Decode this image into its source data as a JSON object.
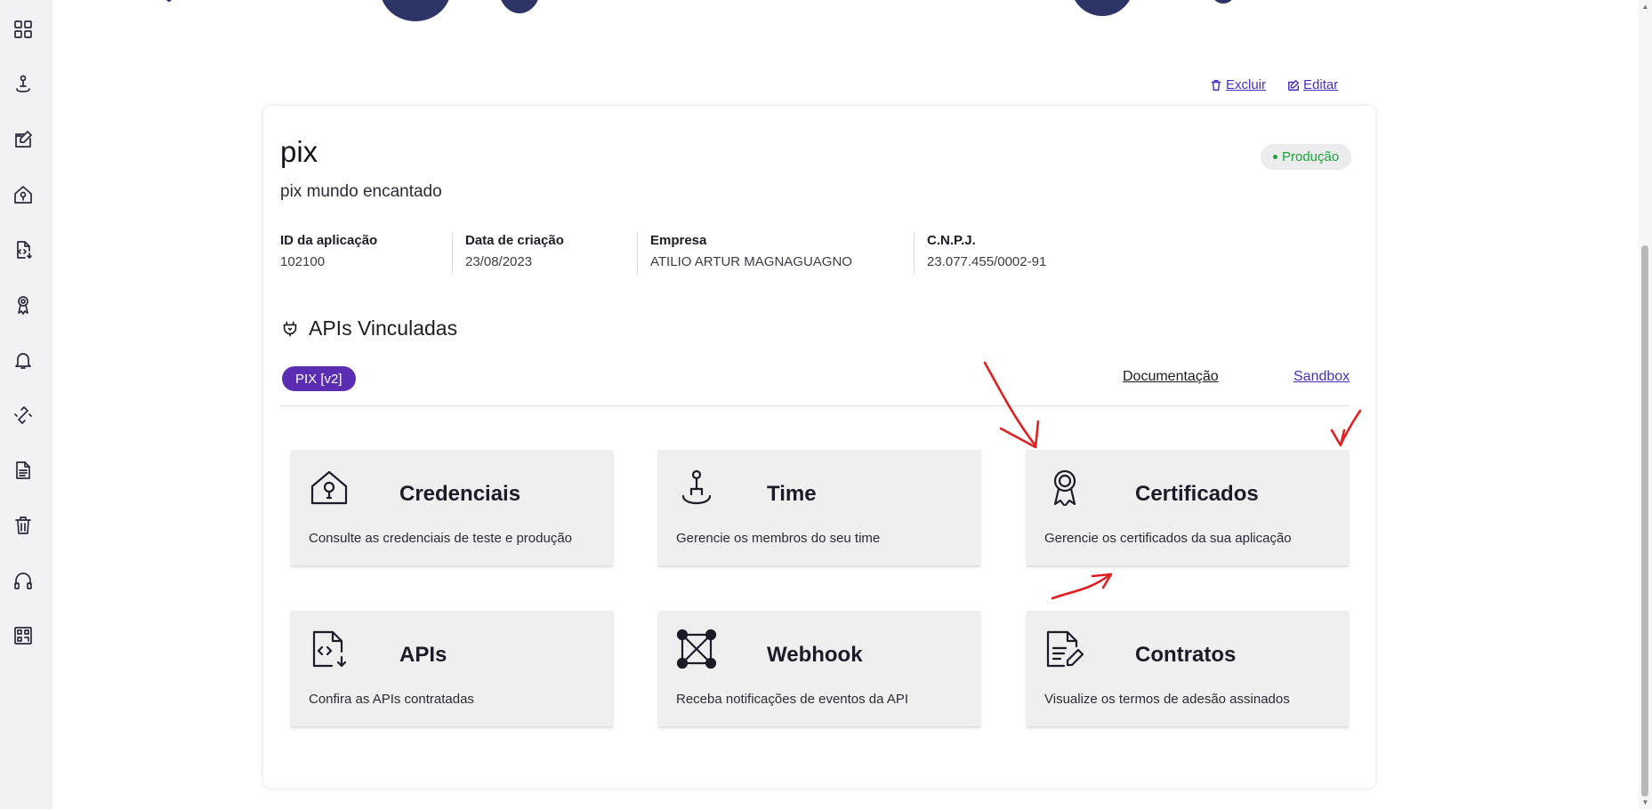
{
  "sidebar": {
    "items": [
      {
        "icon": "dashboard-grid-icon"
      },
      {
        "icon": "person-pin-icon"
      },
      {
        "icon": "edit-square-icon"
      },
      {
        "icon": "key-house-icon"
      },
      {
        "icon": "api-file-icon"
      },
      {
        "icon": "award-icon"
      },
      {
        "icon": "bell-icon"
      },
      {
        "icon": "link-icon"
      },
      {
        "icon": "document-icon"
      },
      {
        "icon": "trash-icon"
      },
      {
        "icon": "headset-icon"
      },
      {
        "icon": "qr-code-icon"
      }
    ]
  },
  "actions": {
    "delete_label": "Excluir",
    "edit_label": "Editar"
  },
  "application": {
    "name": "pix",
    "description": "pix mundo encantado",
    "environment": "Produção",
    "environment_color": "#19a33a"
  },
  "info": [
    {
      "label": "ID da aplicação",
      "value": "102100"
    },
    {
      "label": "Data de criação",
      "value": "23/08/2023"
    },
    {
      "label": "Empresa",
      "value": "ATILIO ARTUR MAGNAGUAGNO"
    },
    {
      "label": "C.N.P.J.",
      "value": "23.077.455/0002-91"
    }
  ],
  "apis_section": {
    "heading": "APIs Vinculadas",
    "active_api": "PIX [v2]",
    "active_api_color": "#5a2db3",
    "documentation_link": "Documentação",
    "sandbox_link": "Sandbox"
  },
  "tiles": [
    {
      "title": "Credenciais",
      "description": "Consulte as credenciais de teste e produção",
      "icon": "key-house-icon"
    },
    {
      "title": "Time",
      "description": "Gerencie os membros do seu time",
      "icon": "person-pin-icon"
    },
    {
      "title": "Certificados",
      "description": "Gerencie os certificados da sua aplicação",
      "icon": "award-icon"
    },
    {
      "title": "APIs",
      "description": "Confira as APIs contratadas",
      "icon": "api-file-icon"
    },
    {
      "title": "Webhook",
      "description": "Receba notificações de eventos da API",
      "icon": "webhook-nodes-icon"
    },
    {
      "title": "Contratos",
      "description": "Visualize os termos de adesão assinados",
      "icon": "contract-sign-icon"
    }
  ],
  "annotation_color": "#e02020"
}
